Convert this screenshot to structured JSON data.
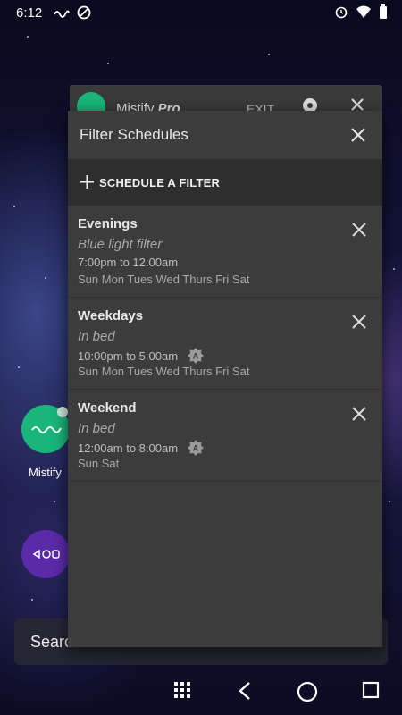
{
  "status_bar": {
    "time": "6:12"
  },
  "background_app": {
    "title": "Mistify",
    "title_suffix": "Pro",
    "exit_label": "EXIT"
  },
  "home": {
    "app_label": "Mistify",
    "search_text": "Search"
  },
  "dialog": {
    "title": "Filter Schedules",
    "add_label": "SCHEDULE A FILTER",
    "schedules": [
      {
        "name": "Evenings",
        "filter": "Blue light filter",
        "time": "7:00pm to 12:00am",
        "days": "Sun Mon Tues Wed Thurs Fri Sat",
        "auto": false
      },
      {
        "name": "Weekdays",
        "filter": "In bed",
        "time": "10:00pm to 5:00am",
        "days": "Sun Mon Tues Wed Thurs Fri Sat",
        "auto": true,
        "auto_letter": "A"
      },
      {
        "name": "Weekend",
        "filter": "In bed",
        "time": "12:00am to 8:00am",
        "days": "Sun Sat",
        "auto": true,
        "auto_letter": "A"
      }
    ]
  },
  "colors": {
    "accent": "#19b57a",
    "dialog_bg": "#3c3c3c",
    "header_bg": "#2e2e2e"
  }
}
